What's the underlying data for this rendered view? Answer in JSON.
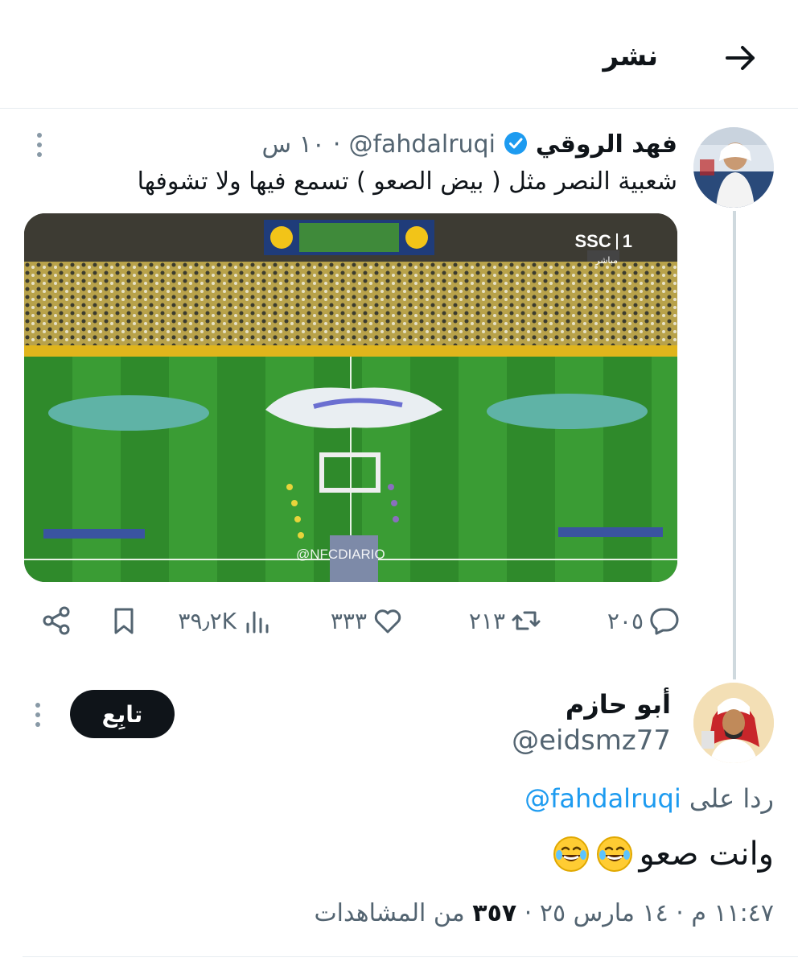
{
  "header": {
    "title": "نشر"
  },
  "tweet": {
    "author_name": "فهد الروقي",
    "handle": "@fahdalruqi",
    "time": "١٠ س",
    "text": "شعبية النصر مثل ( بيض الصعو ) تسمع فيها ولا تشوفها",
    "media": {
      "broadcaster": "SSC",
      "channel": "1",
      "live_label": "مباشر",
      "watermark": "@NFCDIARIO"
    },
    "actions": {
      "replies": "٢٠٥",
      "retweets": "٢١٣",
      "likes": "٣٣٣",
      "views": "٣٩٫٢K"
    }
  },
  "reply": {
    "author_name": "أبو حازم",
    "handle": "@eidsmz77",
    "follow_label": "تابِع",
    "replying_to_prefix": "ردا على",
    "replying_to_handle": "@fahdalruqi",
    "text": "وانت صعو",
    "time_date": "١١:٤٧ م · ١٤ مارس ٢٥ ·",
    "views_count": "٣٥٧",
    "views_label": "من المشاهدات"
  },
  "colors": {
    "accent": "#1d9bf0",
    "verified": "#1d9bf0",
    "text": "#0f1419",
    "muted": "#536471"
  }
}
